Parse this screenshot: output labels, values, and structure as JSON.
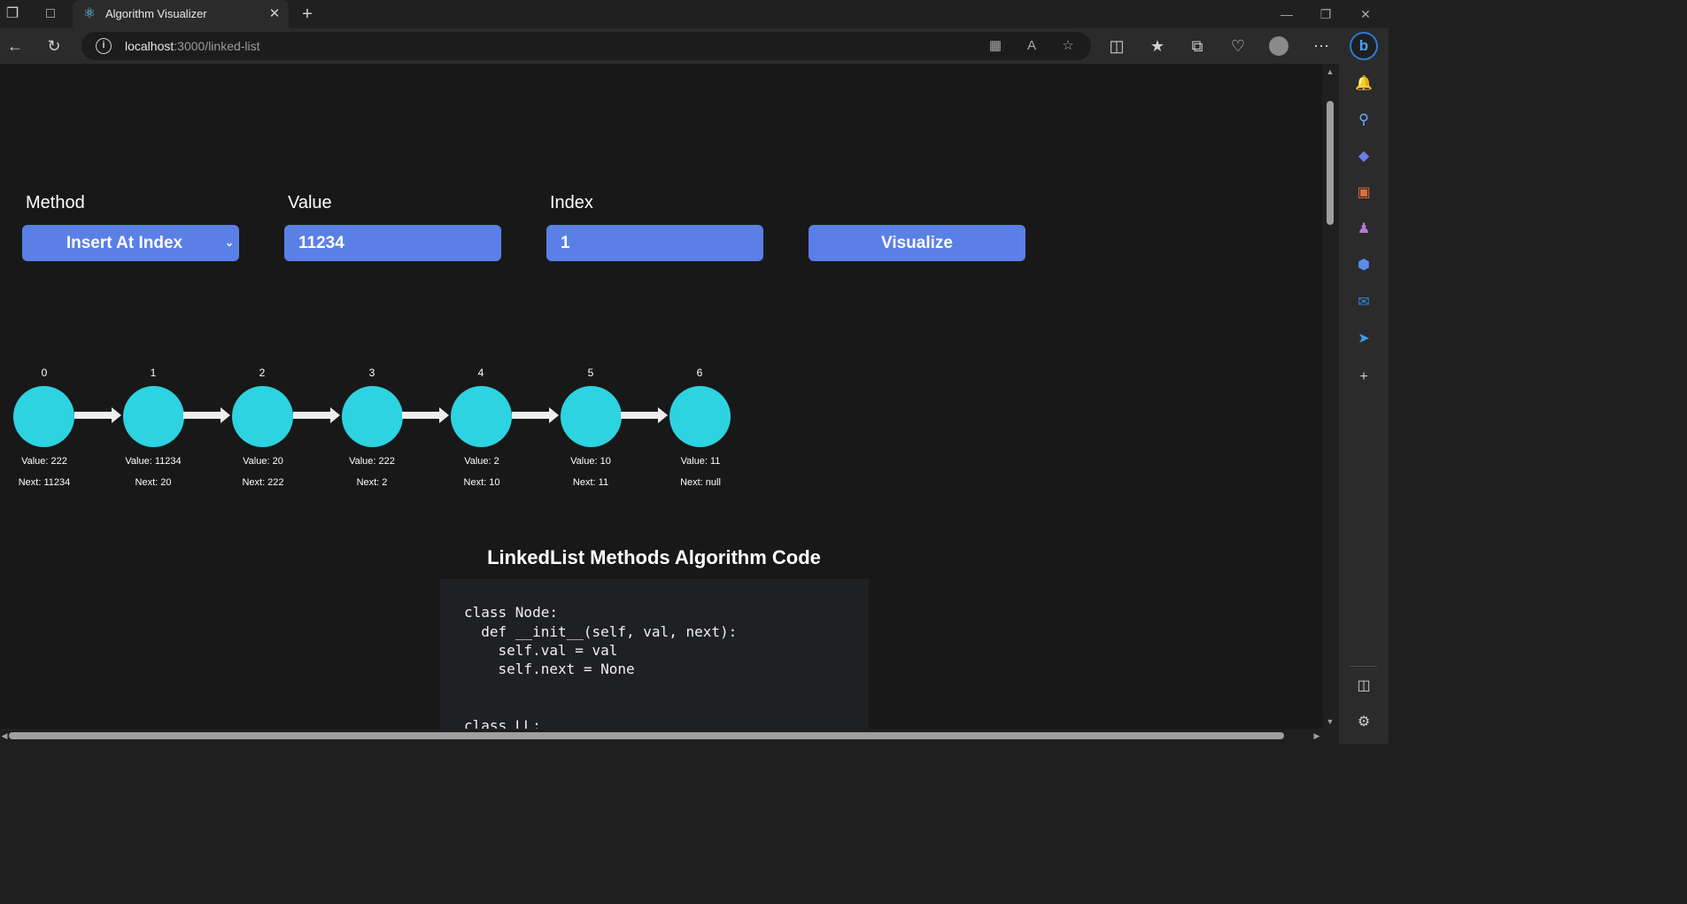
{
  "browser": {
    "tab_title": "Algorithm Visualizer",
    "url_host": "localhost",
    "url_rest": ":3000/linked-list"
  },
  "controls": {
    "method_label": "Method",
    "method_value": "Insert At Index",
    "value_label": "Value",
    "value_value": "11234",
    "index_label": "Index",
    "index_value": "1",
    "visualize_label": "Visualize"
  },
  "linked_list": {
    "nodes": [
      {
        "index": "0",
        "value": "Value: 222",
        "next": "Next: 11234"
      },
      {
        "index": "1",
        "value": "Value: 11234",
        "next": "Next: 20"
      },
      {
        "index": "2",
        "value": "Value: 20",
        "next": "Next: 222"
      },
      {
        "index": "3",
        "value": "Value: 222",
        "next": "Next: 2"
      },
      {
        "index": "4",
        "value": "Value: 2",
        "next": "Next: 10"
      },
      {
        "index": "5",
        "value": "Value: 10",
        "next": "Next: 11"
      },
      {
        "index": "6",
        "value": "Value: 11",
        "next": "Next: null"
      }
    ],
    "node_color": "#2dd3e0"
  },
  "code": {
    "title": "LinkedList Methods Algorithm Code",
    "lines": [
      "class Node:",
      "  def __init__(self, val, next):",
      "    self.val = val",
      "    self.next = None",
      "",
      "",
      "class LL:"
    ]
  },
  "colors": {
    "accent": "#5a7fe6",
    "page_bg": "#181818",
    "node": "#2dd3e0"
  }
}
